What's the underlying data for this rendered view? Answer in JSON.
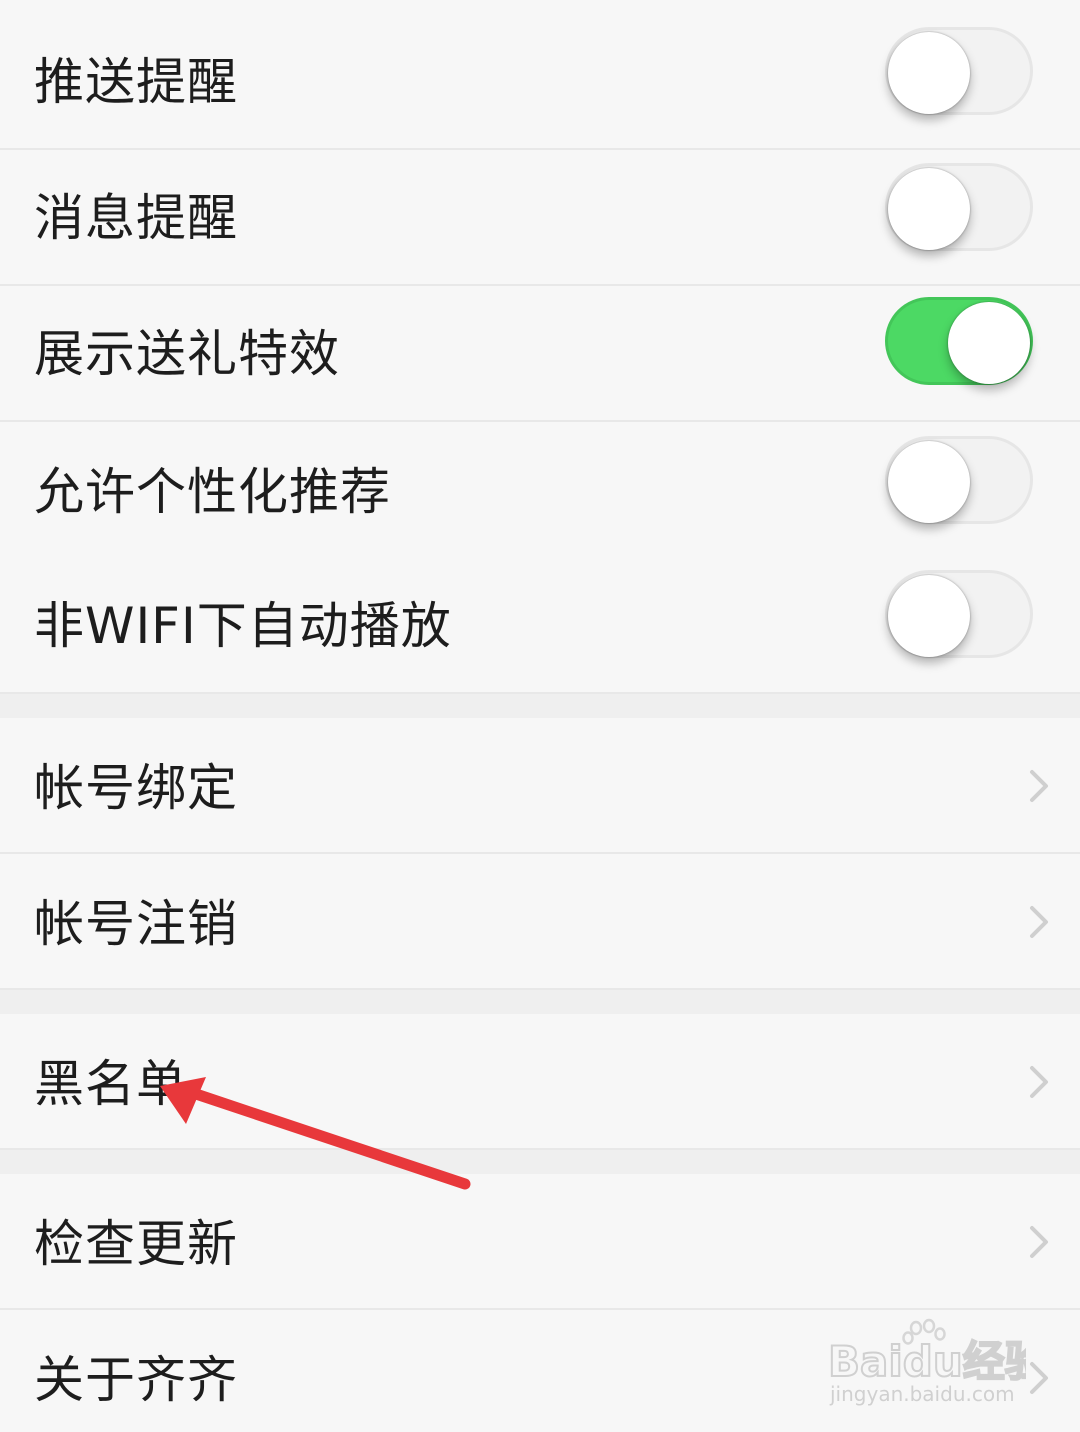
{
  "settings": {
    "toggles": [
      {
        "label": "推送提醒",
        "on": false
      },
      {
        "label": "消息提醒",
        "on": false
      },
      {
        "label": "展示送礼特效",
        "on": true
      },
      {
        "label": "允许个性化推荐",
        "on": false
      },
      {
        "label": "非WIFI下自动播放",
        "on": false
      }
    ],
    "account": [
      {
        "label": "帐号绑定"
      },
      {
        "label": "帐号注销"
      }
    ],
    "blacklist": {
      "label": "黑名单"
    },
    "about": [
      {
        "label": "检查更新"
      },
      {
        "label": "关于齐齐"
      }
    ]
  },
  "colors": {
    "toggle_on": "#4cd964",
    "toggle_off": "#f2f2f2",
    "arrow": "#e8383b",
    "background": "#f7f7f7"
  },
  "watermark": {
    "brand": "Baidu经验",
    "url": "jingyan.baidu.com"
  }
}
